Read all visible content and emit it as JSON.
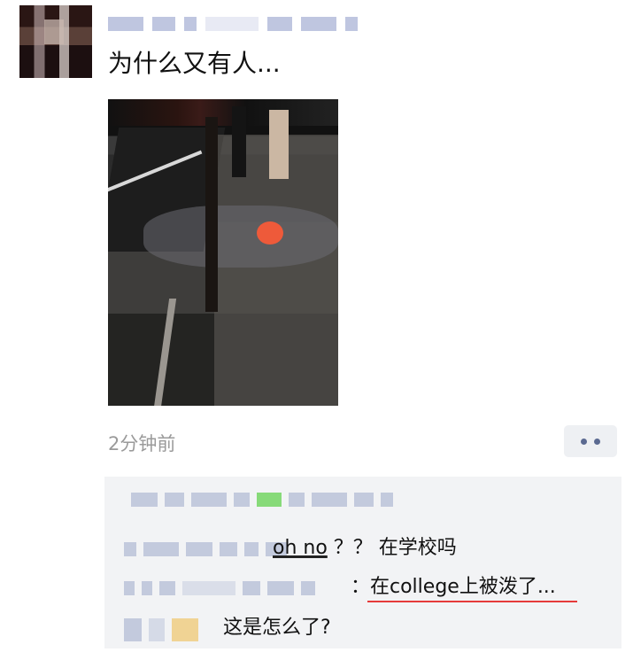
{
  "post": {
    "text": "为什么又有人...",
    "time": "2分钟前"
  },
  "comments": [
    {
      "text": "oh no",
      "rest": "？？ 在学校吗"
    },
    {
      "text": "：在college上被泼了..."
    },
    {
      "text": "这是怎么了?"
    }
  ],
  "colors": {
    "name_link": "#5b6a91",
    "underline_red": "#e63a3a",
    "comment_bg": "#f2f3f5"
  },
  "icons": {
    "more": "more-options-icon"
  }
}
